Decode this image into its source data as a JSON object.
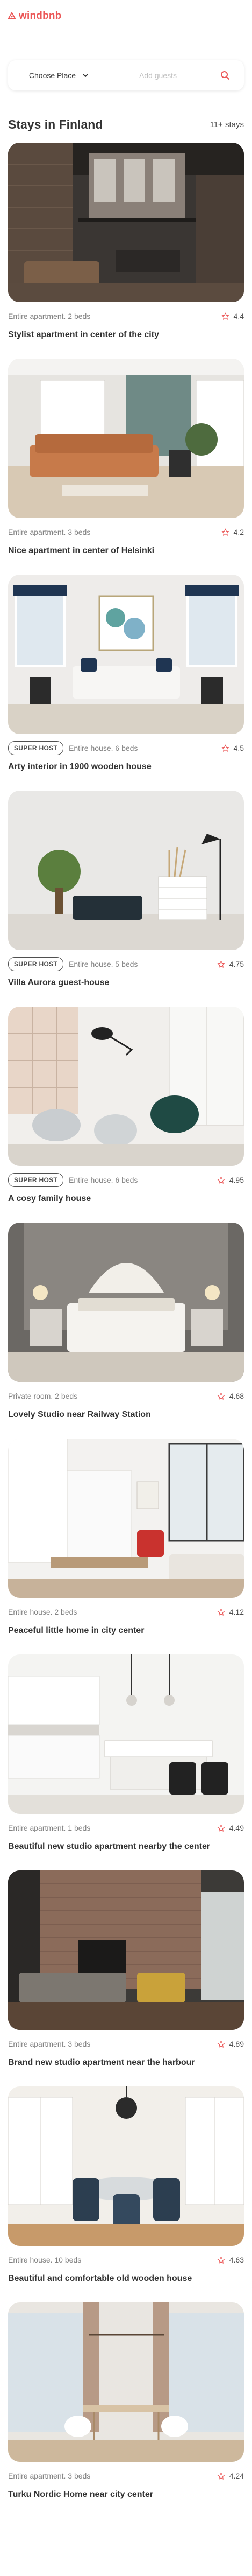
{
  "brand": {
    "name": "windbnb",
    "accent": "#eb5757"
  },
  "search": {
    "location": "Choose Place",
    "guests_placeholder": "Add guests",
    "location_icon": "chevron-down-icon",
    "search_icon": "search-icon"
  },
  "section": {
    "title": "Stays in Finland",
    "count": "11+ stays"
  },
  "stays": [
    {
      "superhost": "",
      "type": "Entire apartment. 2 beds",
      "rating": "4.4",
      "title": "Stylist apartment in center of the city"
    },
    {
      "superhost": "",
      "type": "Entire apartment. 3 beds",
      "rating": "4.2",
      "title": "Nice apartment in center of Helsinki"
    },
    {
      "superhost": "SUPER HOST",
      "type": "Entire house. 6 beds",
      "rating": "4.5",
      "title": "Arty interior in 1900 wooden house"
    },
    {
      "superhost": "SUPER HOST",
      "type": "Entire house. 5 beds",
      "rating": "4.75",
      "title": "Villa Aurora guest-house"
    },
    {
      "superhost": "SUPER HOST",
      "type": "Entire house. 6 beds",
      "rating": "4.95",
      "title": "A cosy family house"
    },
    {
      "superhost": "",
      "type": "Private room. 2 beds",
      "rating": "4.68",
      "title": "Lovely Studio near Railway Station"
    },
    {
      "superhost": "",
      "type": "Entire house. 2 beds",
      "rating": "4.12",
      "title": "Peaceful little home in city center"
    },
    {
      "superhost": "",
      "type": "Entire apartment. 1 beds",
      "rating": "4.49",
      "title": "Beautiful new studio apartment nearby the center"
    },
    {
      "superhost": "",
      "type": "Entire apartment. 3 beds",
      "rating": "4.89",
      "title": "Brand new studio apartment near the harbour"
    },
    {
      "superhost": "",
      "type": "Entire house. 10 beds",
      "rating": "4.63",
      "title": "Beautiful and comfortable old wooden house"
    },
    {
      "superhost": "",
      "type": "Entire apartment. 3 beds",
      "rating": "4.24",
      "title": "Turku Nordic Home near city center"
    }
  ],
  "colors": {
    "star": "#eb5757",
    "text": "#333333",
    "muted": "#828282"
  }
}
